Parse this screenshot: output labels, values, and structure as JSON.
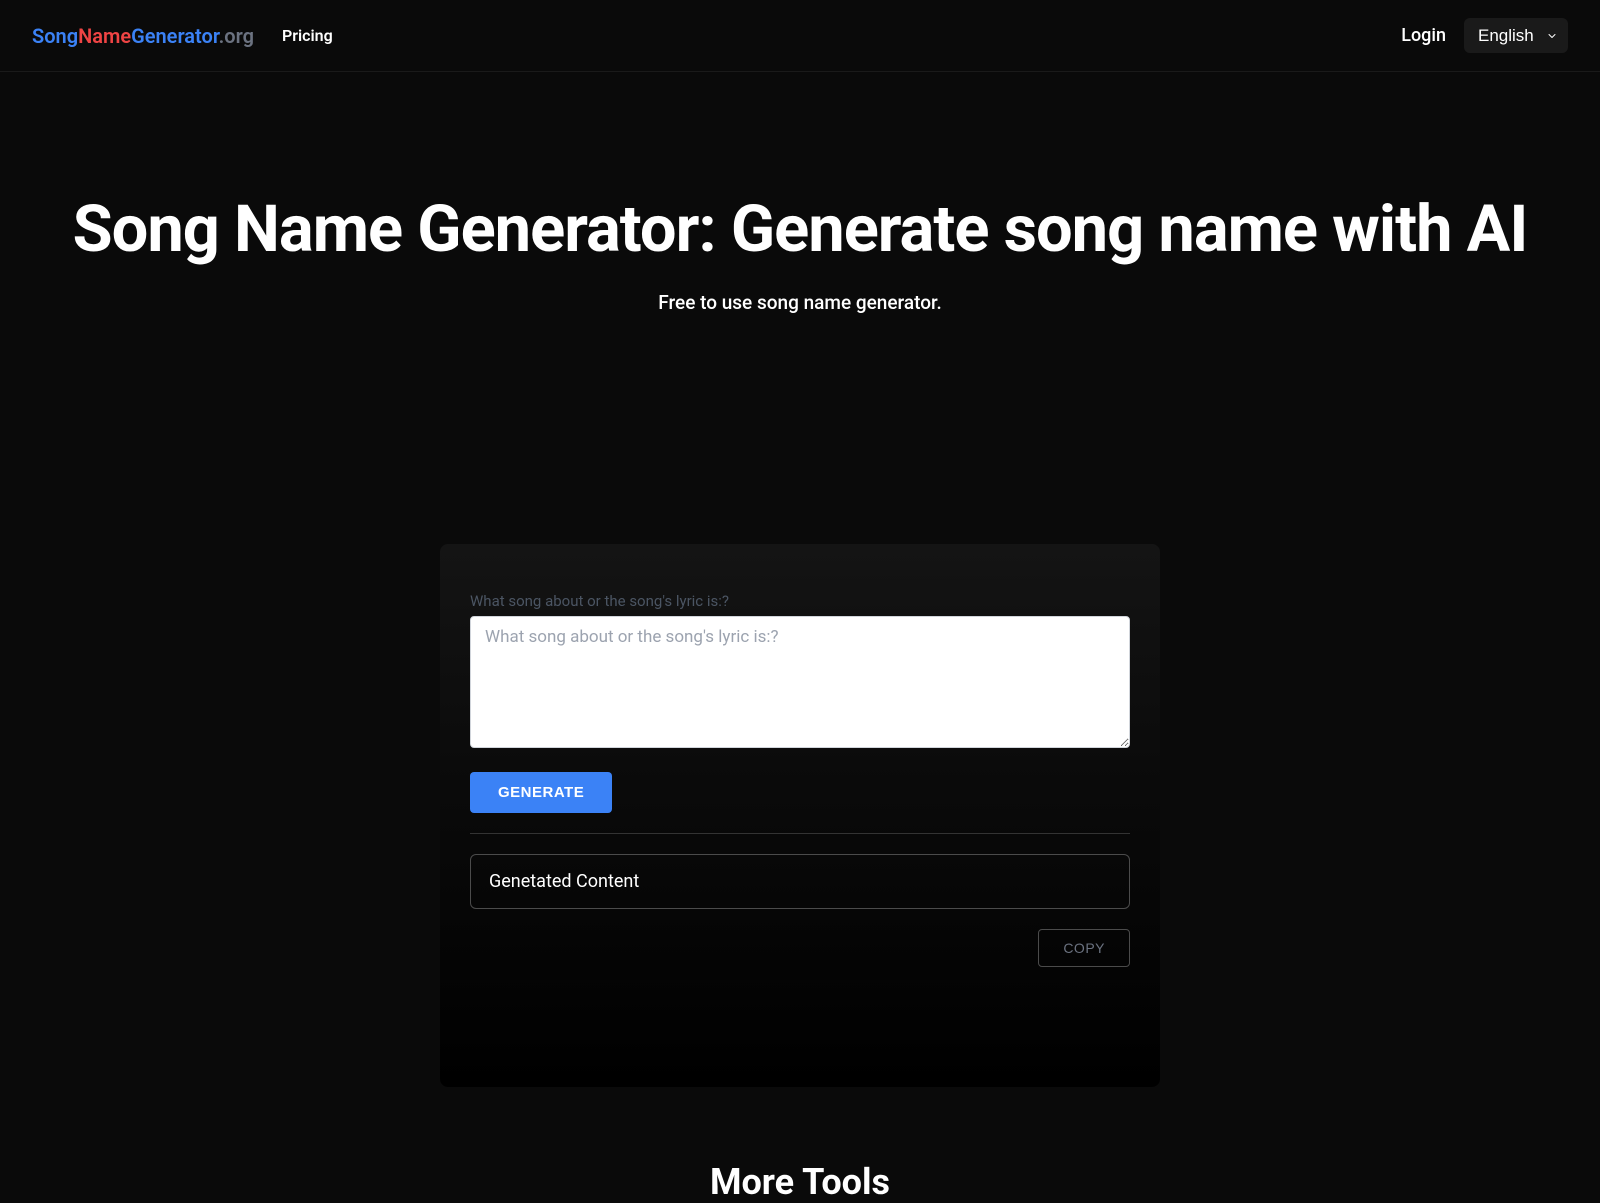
{
  "header": {
    "logo": {
      "song": "Song",
      "name": "Name",
      "generator": "Generator",
      "org": ".org"
    },
    "nav": {
      "pricing": "Pricing"
    },
    "login": "Login",
    "language": {
      "selected": "English"
    }
  },
  "hero": {
    "title": "Song Name Generator: Generate song name with AI",
    "subtitle": "Free to use song name generator."
  },
  "generator": {
    "label": "What song about or the song's lyric is:?",
    "placeholder": "What song about or the song's lyric is:?",
    "generate_button": "GENERATE",
    "output_placeholder": "Genetated Content",
    "copy_button": "COPY"
  },
  "more_tools": {
    "title": "More Tools"
  }
}
